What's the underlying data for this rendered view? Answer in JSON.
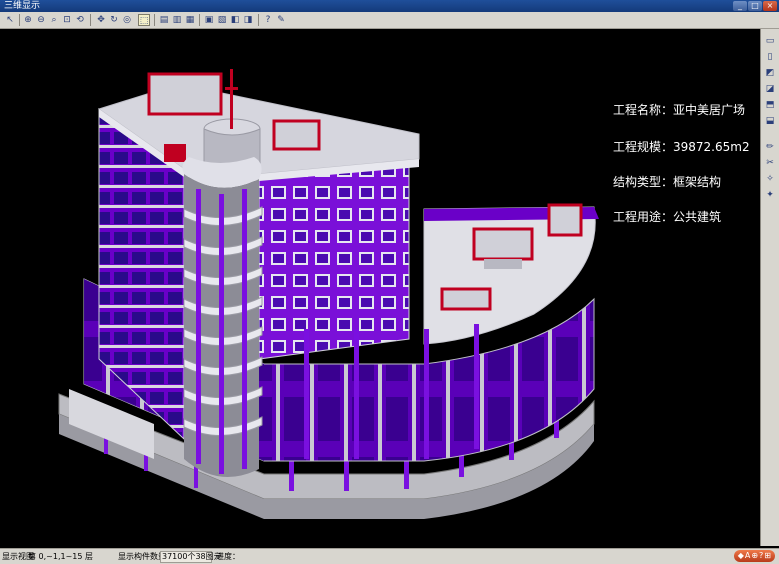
{
  "window": {
    "title": "三维显示",
    "controls": [
      "_",
      "□",
      "×"
    ]
  },
  "toolbar": {
    "icons": [
      "cursor-icon",
      "zoom-in-icon",
      "zoom-out-icon",
      "zoom-extent-icon",
      "zoom-window-icon",
      "zoom-previous-icon",
      "pan-icon",
      "rotate-icon",
      "orbit-icon",
      "select-icon",
      "front-view-icon",
      "side-view-icon",
      "top-view-icon",
      "layer-icon",
      "properties-icon",
      "render-icon",
      "shade-icon",
      "wireframe-icon",
      "help-icon",
      "settings-icon"
    ]
  },
  "info": {
    "name": "工程名称：亚中美居广场",
    "scale": "工程规模：39872.65m2",
    "structure": "结构类型：框架结构",
    "usage": "工程用途：公共建筑"
  },
  "statusbar": {
    "label_view": "显示视图",
    "floor_value": "第 0,~1,1~15 层",
    "label_count": "显示构件数量：",
    "count_value": "37100个38图元",
    "progress": "进度："
  },
  "tray": {
    "items": [
      "◆",
      "A",
      "⊕",
      "?",
      "⊞"
    ]
  },
  "colors": {
    "accent": "#6a00c8",
    "building_gray": "#b4b4b8",
    "background": "#000000"
  }
}
